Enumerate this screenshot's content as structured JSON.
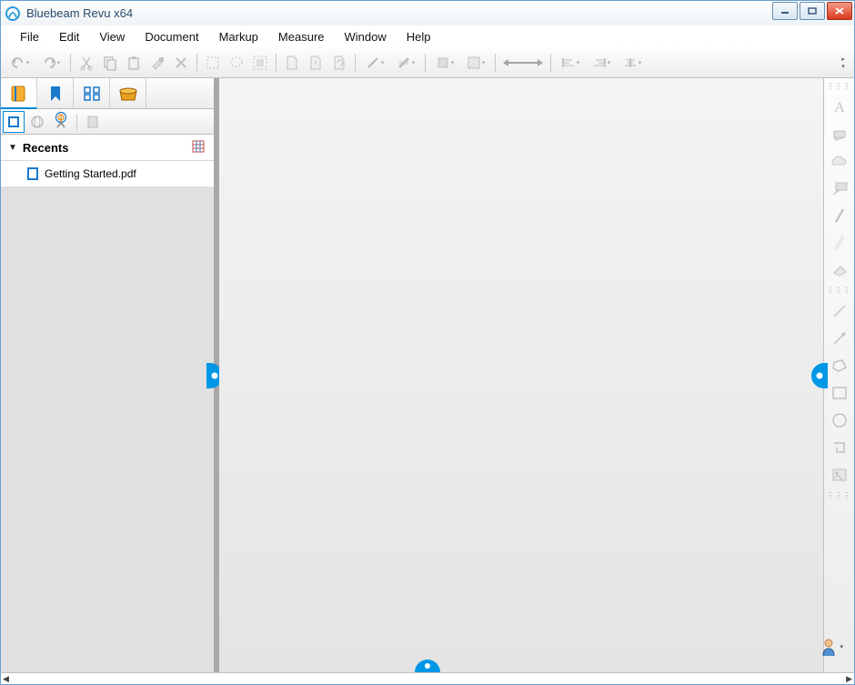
{
  "window": {
    "title": "Bluebeam Revu x64"
  },
  "menu": {
    "items": [
      "File",
      "Edit",
      "View",
      "Document",
      "Markup",
      "Measure",
      "Window",
      "Help"
    ]
  },
  "left_panel": {
    "section_label": "Recents",
    "files": [
      {
        "name": "Getting Started.pdf"
      }
    ]
  }
}
